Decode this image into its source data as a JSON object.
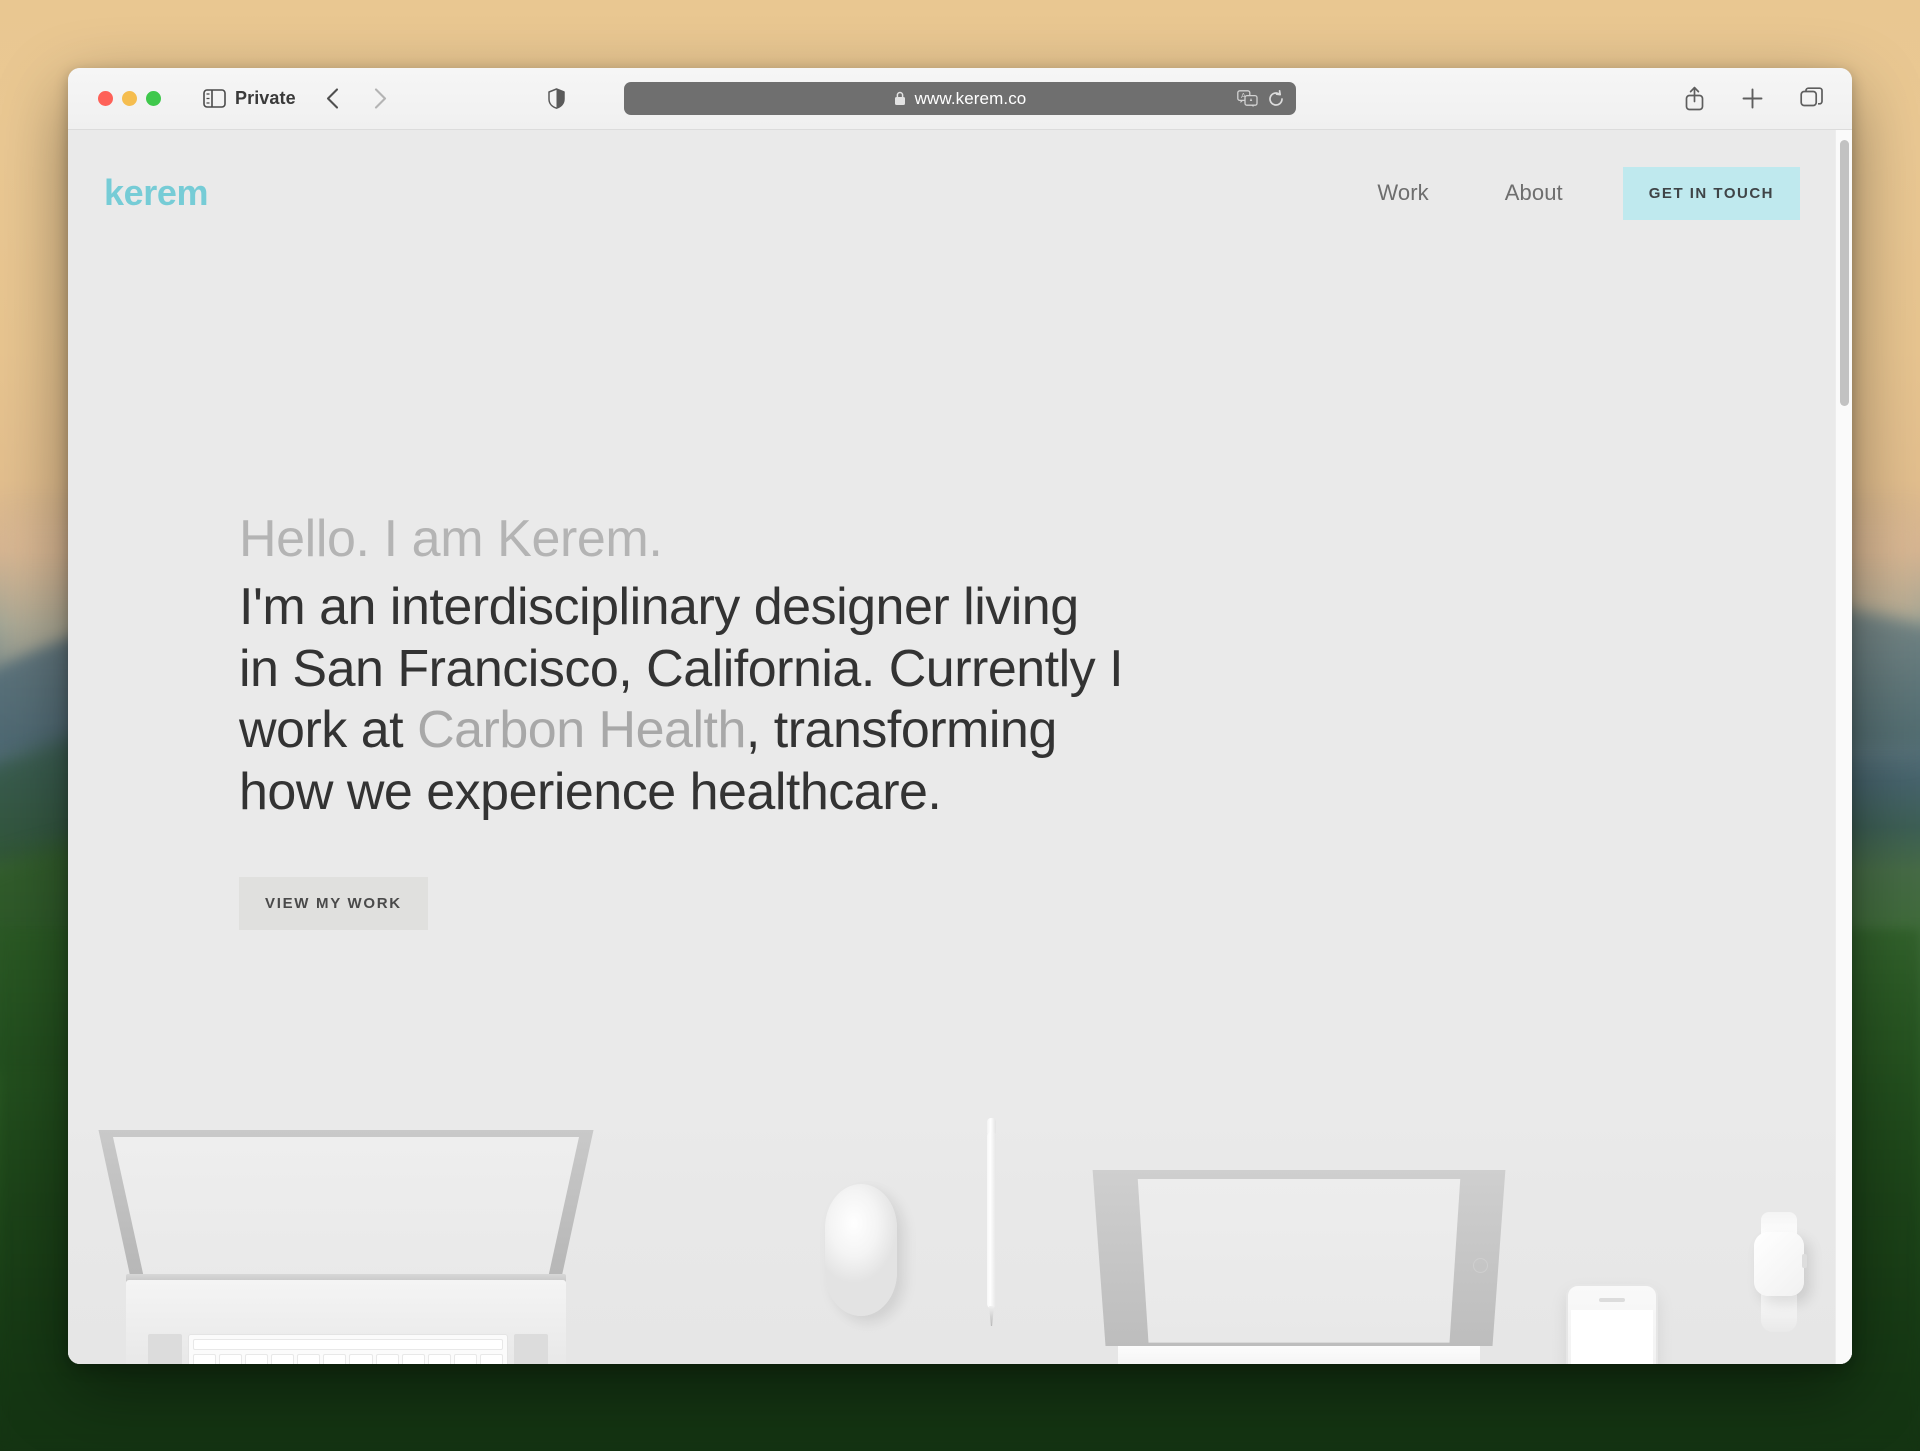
{
  "browser": {
    "name": "Safari",
    "traffic_lights": [
      {
        "name": "close",
        "color": "#fe6158"
      },
      {
        "name": "minimize",
        "color": "#f5bd4f"
      },
      {
        "name": "zoom",
        "color": "#3fc84c"
      }
    ],
    "sidebar_toggle_icon": "sidebar-icon",
    "private_label": "Private",
    "back_icon": "chevron-left-icon",
    "forward_icon": "chevron-right-icon",
    "shield_icon": "privacy-shield-icon",
    "url": {
      "lock_icon": "lock-icon",
      "text": "www.kerem.co",
      "translate_icon": "translate-icon",
      "reload_icon": "reload-icon"
    },
    "share_icon": "share-icon",
    "new_tab_icon": "plus-icon",
    "tab_overview_icon": "tab-overview-icon"
  },
  "site": {
    "logo": "kerem",
    "logo_color": "#76ccd6",
    "nav": [
      {
        "label": "Work"
      },
      {
        "label": "About"
      }
    ],
    "cta": {
      "label": "GET IN TOUCH",
      "background": "#bfe9ee",
      "text_color": "#3f4447"
    },
    "hero": {
      "greeting": "Hello. I am Kerem.",
      "greeting_color": "#b4b4b4",
      "intro_part_1": "I'm an interdisciplinary designer living in San Francisco, California. Currently I work at ",
      "intro_link": "Carbon Health",
      "intro_part_2": ", transforming how we experience healthcare.",
      "text_color": "#333333",
      "link_color": "#a8a8a8"
    },
    "primary_button": {
      "label": "VIEW MY WORK",
      "background": "#e0e0de",
      "text_color": "#4a4a4a"
    },
    "page_background": "#eaeaea",
    "devices": [
      {
        "name": "macbook"
      },
      {
        "name": "magic-mouse"
      },
      {
        "name": "apple-pencil"
      },
      {
        "name": "ipad"
      },
      {
        "name": "iphone"
      },
      {
        "name": "apple-watch"
      }
    ]
  },
  "desktop": {
    "wallpaper": "rolling-green-hills-at-sunset"
  }
}
